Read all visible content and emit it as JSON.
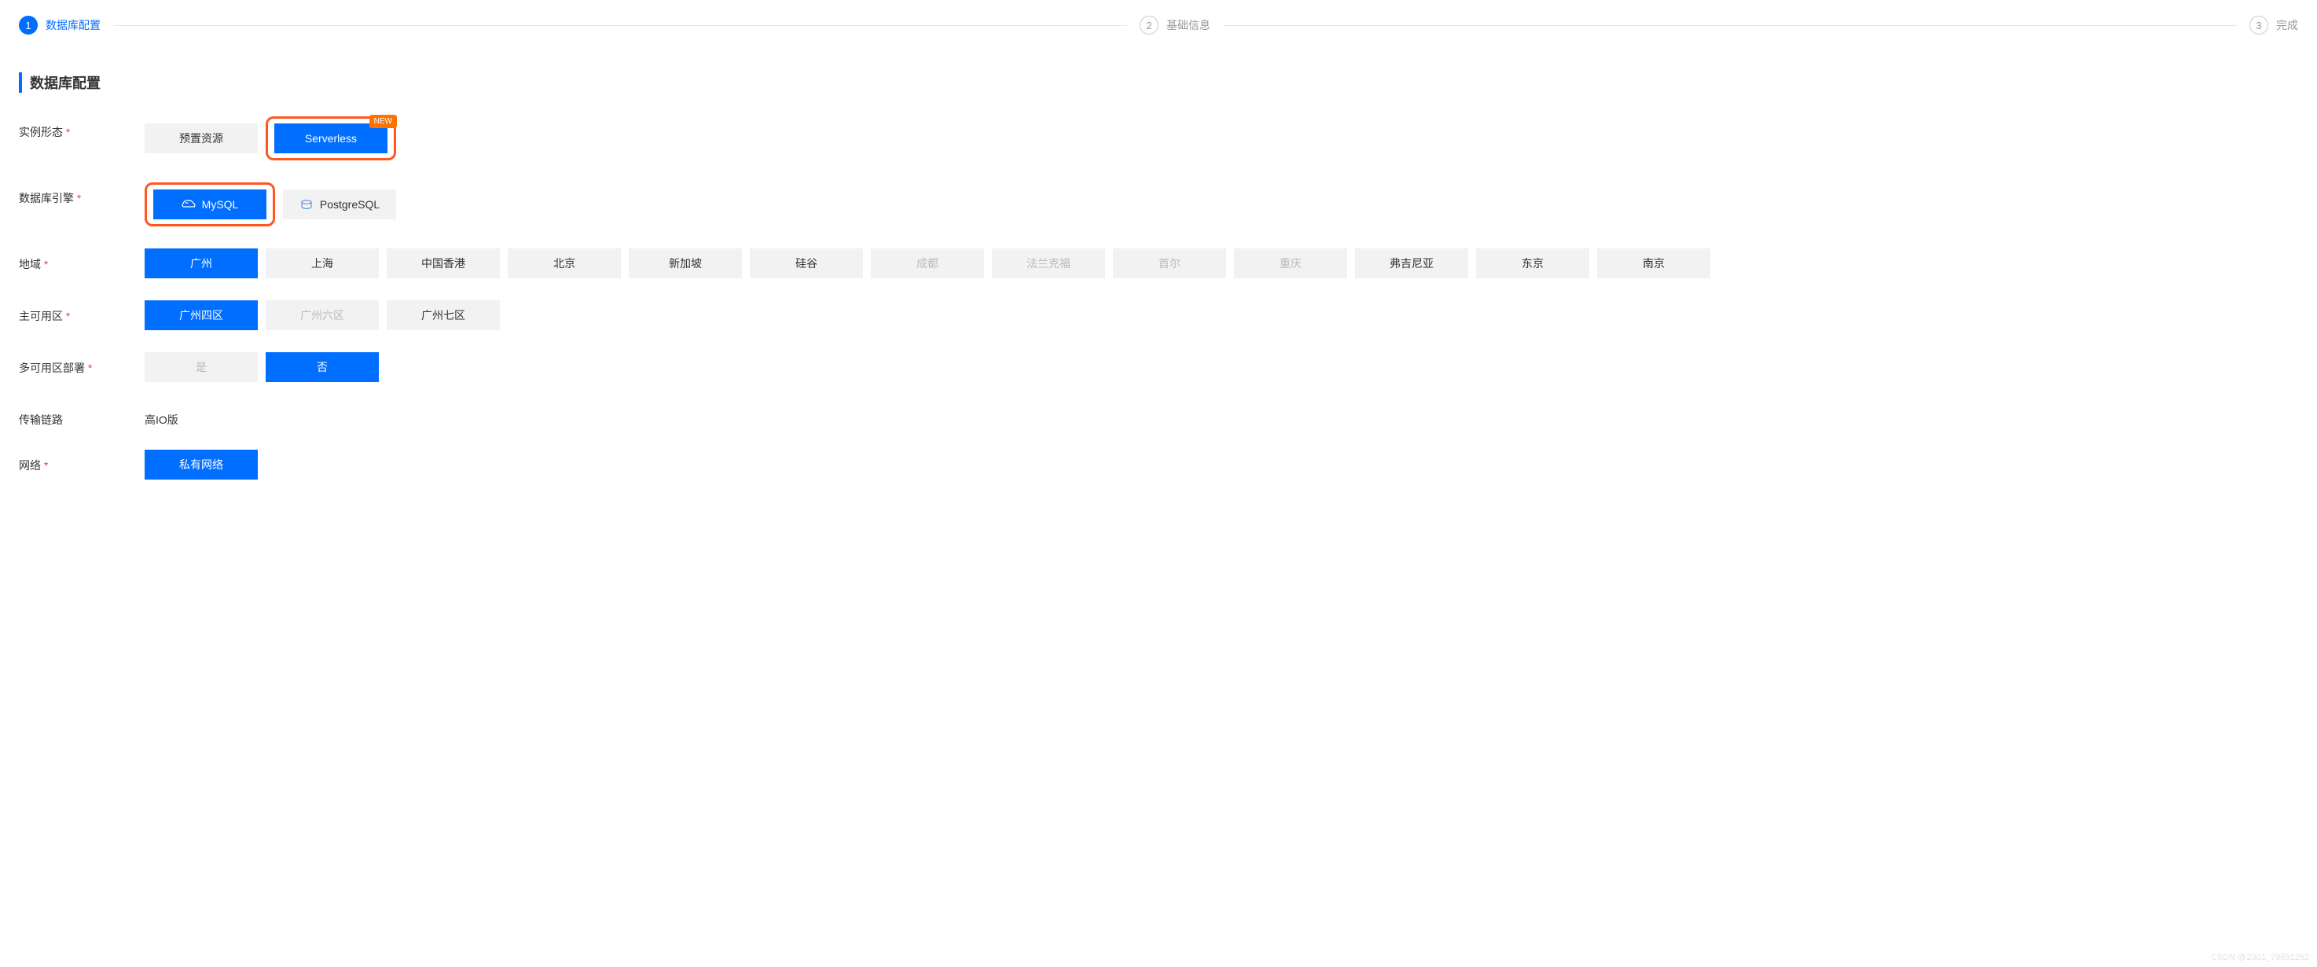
{
  "steps": {
    "s1": {
      "num": "1",
      "label": "数据库配置"
    },
    "s2": {
      "num": "2",
      "label": "基础信息"
    },
    "s3": {
      "num": "3",
      "label": "完成"
    }
  },
  "section_title": "数据库配置",
  "fields": {
    "instance_form": {
      "label": "实例形态",
      "options": {
        "preset": "预置资源",
        "serverless": "Serverless"
      },
      "badge": "NEW"
    },
    "db_engine": {
      "label": "数据库引擎",
      "options": {
        "mysql": "MySQL",
        "postgresql": "PostgreSQL"
      }
    },
    "region": {
      "label": "地域",
      "options": {
        "gz": "广州",
        "sh": "上海",
        "hk": "中国香港",
        "bj": "北京",
        "sg": "新加坡",
        "sv": "硅谷",
        "cd": "成都",
        "fr": "法兰克福",
        "seoul": "首尔",
        "cq": "重庆",
        "va": "弗吉尼亚",
        "tokyo": "东京",
        "nj": "南京"
      }
    },
    "primary_az": {
      "label": "主可用区",
      "options": {
        "gz4": "广州四区",
        "gz6": "广州六区",
        "gz7": "广州七区"
      }
    },
    "multi_az": {
      "label": "多可用区部署",
      "options": {
        "yes": "是",
        "no": "否"
      }
    },
    "transport": {
      "label": "传输链路",
      "value": "高IO版"
    },
    "network": {
      "label": "网络",
      "options": {
        "vpc": "私有网络"
      }
    }
  },
  "watermark": "CSDN @2301_79651252"
}
